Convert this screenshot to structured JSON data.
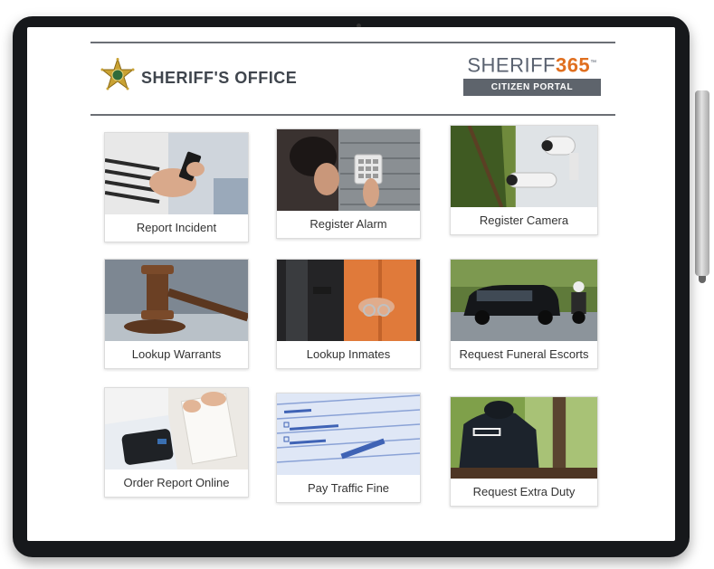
{
  "header": {
    "title": "SHERIFF'S OFFICE",
    "brand_word": "SHERIFF",
    "brand_number": "365",
    "brand_trademark": "™",
    "brand_subtitle": "CITIZEN PORTAL"
  },
  "tiles": [
    {
      "label": "Report Incident",
      "icon": "hands-phone-image"
    },
    {
      "label": "Register Alarm",
      "icon": "alarm-keypad-image"
    },
    {
      "label": "Register Camera",
      "icon": "security-camera-image"
    },
    {
      "label": "Lookup Warrants",
      "icon": "gavel-image"
    },
    {
      "label": "Lookup Inmates",
      "icon": "handcuffed-inmate-image"
    },
    {
      "label": "Request Funeral Escorts",
      "icon": "funeral-motorcade-image"
    },
    {
      "label": "Order Report Online",
      "icon": "officer-reading-report-image"
    },
    {
      "label": "Pay Traffic Fine",
      "icon": "traffic-citation-image"
    },
    {
      "label": "Request Extra Duty",
      "icon": "police-officer-back-image"
    }
  ],
  "colors": {
    "brand_gray": "#5a6270",
    "brand_orange": "#e06f1f",
    "badge_gold": "#c9a233",
    "badge_green": "#2f6b3a",
    "bezel": "#16181b"
  }
}
